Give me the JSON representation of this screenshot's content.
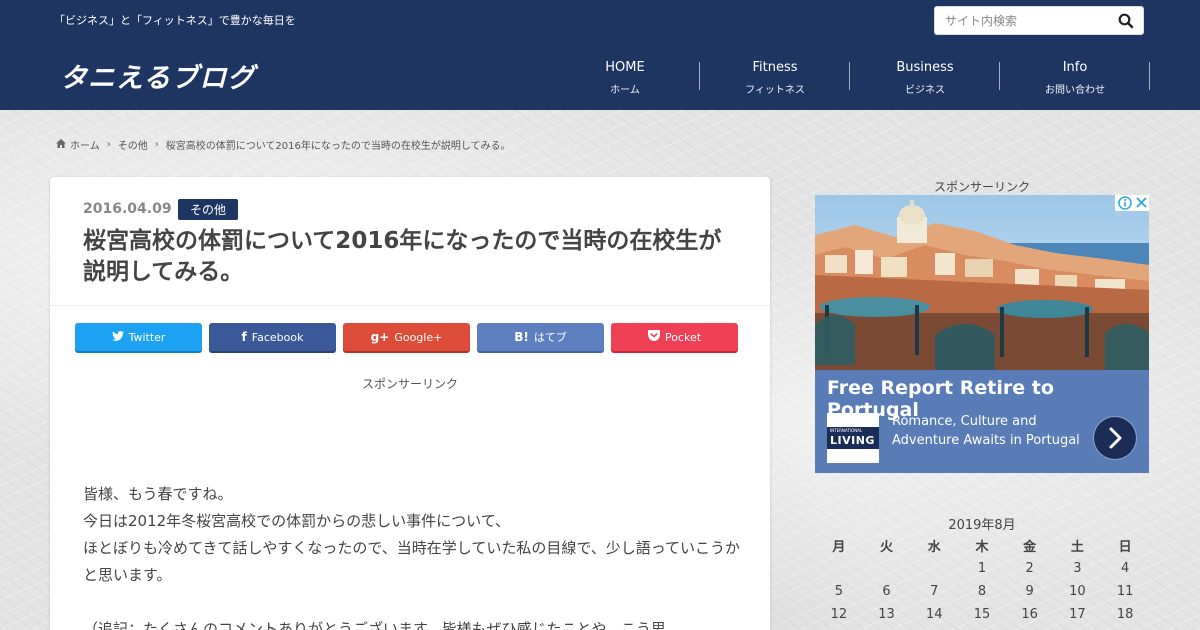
{
  "header": {
    "tagline": "「ビジネス」と「フィットネス」で豊かな毎日を",
    "logo": "タニえるブログ",
    "search_placeholder": "サイト内検索",
    "search_icon": "search-icon",
    "nav": [
      {
        "label": "HOME",
        "sub": "ホーム"
      },
      {
        "label": "Fitness",
        "sub": "フィットネス"
      },
      {
        "label": "Business",
        "sub": "ビジネス"
      },
      {
        "label": "Info",
        "sub": "お問い合わせ"
      }
    ],
    "bg_color": "#1f3561"
  },
  "breadcrumb": {
    "home": "ホーム",
    "category": "その他",
    "current": "桜宮高校の体罰について2016年になったので当時の在校生が説明してみる。"
  },
  "article": {
    "date": "2016.04.09",
    "category": "その他",
    "title": "桜宮高校の体罰について2016年になったので当時の在校生が説明してみる。",
    "share": [
      {
        "label": "Twitter",
        "icon": "twitter-icon",
        "color": "#1da1f2"
      },
      {
        "label": "Facebook",
        "icon": "facebook-icon",
        "color": "#3b5998"
      },
      {
        "label": "Google+",
        "icon": "google-plus-icon",
        "color": "#dd4b39"
      },
      {
        "label": "はてブ",
        "icon": "hatena-bookmark-icon",
        "color": "#5d7fbf"
      },
      {
        "label": "Pocket",
        "icon": "pocket-icon",
        "color": "#ef4056"
      }
    ],
    "sponsor": "スポンサーリンク",
    "paragraphs": {
      "p1": "皆様、もう春ですね。",
      "p2": "今日は2012年冬桜宮高校での体罰からの悲しい事件について、",
      "p3": "ほとぼりも冷めてきて話しやすくなったので、当時在学していた私の目線で、少し語っていこうかと思います。",
      "p4": "（追記：たくさんのコメントありがとうございます。皆様もぜひ感じたことや、こう思"
    }
  },
  "sidebar": {
    "sponsor": "スポンサーリンク",
    "ad": {
      "title": "Free Report Retire to Portugal",
      "logo_small": "INTERNATIONAL",
      "logo_big": "LIVING",
      "description": "Romance, Culture and Adventure Awaits in Portugal",
      "bg_color": "#5a7cb6"
    },
    "calendar": {
      "caption": "2019年8月",
      "weekdays": [
        "月",
        "火",
        "水",
        "木",
        "金",
        "土",
        "日"
      ],
      "rows": [
        [
          "",
          "",
          "",
          "1",
          "2",
          "3",
          "4"
        ],
        [
          "5",
          "6",
          "7",
          "8",
          "9",
          "10",
          "11"
        ],
        [
          "12",
          "13",
          "14",
          "15",
          "16",
          "17",
          "18"
        ]
      ]
    }
  }
}
